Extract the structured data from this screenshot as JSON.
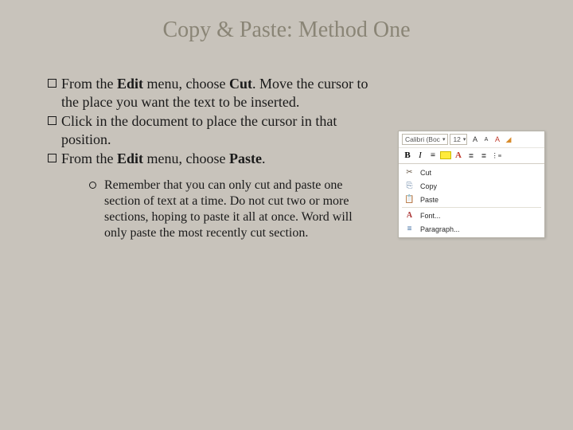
{
  "title": "Copy & Paste: Method One",
  "bullets": {
    "b1": {
      "pre": "From the ",
      "bold1": "Edit",
      "mid": " menu, choose ",
      "bold2": "Cut",
      "post": ". Move the cursor to the place you want the text to be inserted."
    },
    "b2": {
      "text": "Click in the document to place the cursor in that position."
    },
    "b3": {
      "pre": "From the ",
      "bold1": "Edit",
      "mid": " menu, choose ",
      "bold2": "Paste",
      "post": "."
    }
  },
  "sub": "Remember that you can only cut and paste one section of text at a time. Do not cut two or more sections, hoping to paste it all at once. Word will only paste the most recently cut section.",
  "menu": {
    "font_name": "Calibri (Boc",
    "font_size": "12",
    "cut": "Cut",
    "copy": "Copy",
    "paste": "Paste",
    "font": "Font...",
    "paragraph": "Paragraph..."
  }
}
